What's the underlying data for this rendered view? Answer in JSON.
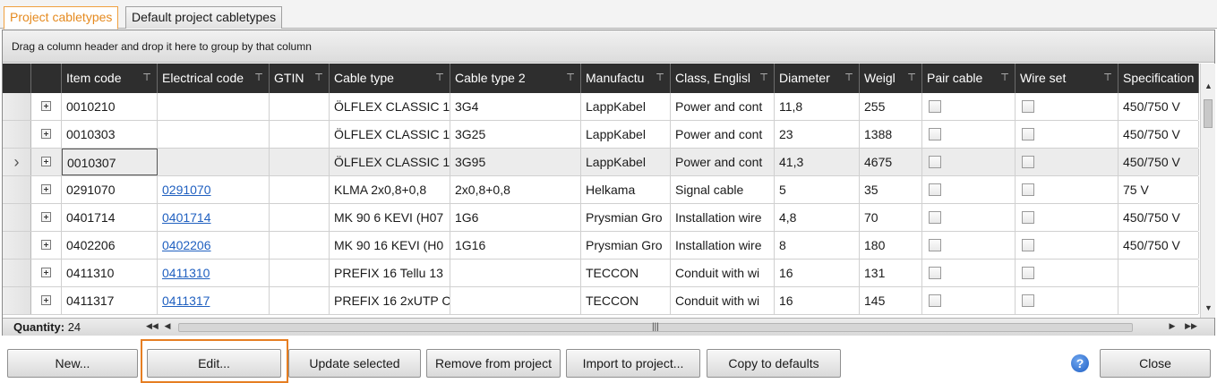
{
  "tabs": [
    {
      "label": "Project cabletypes",
      "active": true
    },
    {
      "label": "Default project cabletypes",
      "active": false
    }
  ],
  "group_panel_text": "Drag a column header and drop it here to group by that column",
  "columns": [
    "Item code",
    "Electrical code",
    "GTIN",
    "Cable type",
    "Cable type 2",
    "Manufactu",
    "Class, Englisl",
    "Diameter",
    "Weigl",
    "Pair cable",
    "Wire set",
    "Specification"
  ],
  "rows": [
    {
      "item_code": "0010210",
      "electrical_code": "",
      "gtin": "",
      "cable_type": "ÖLFLEX CLASSIC 1(",
      "cable_type2": "3G4",
      "manufacturer": "LappKabel",
      "class": "Power and cont",
      "diameter": "11,8",
      "weight": "255",
      "specification": "450/750 V",
      "selected": false
    },
    {
      "item_code": "0010303",
      "electrical_code": "",
      "gtin": "",
      "cable_type": "ÖLFLEX CLASSIC 1(",
      "cable_type2": "3G25",
      "manufacturer": "LappKabel",
      "class": "Power and cont",
      "diameter": "23",
      "weight": "1388",
      "specification": "450/750 V",
      "selected": false
    },
    {
      "item_code": "0010307",
      "electrical_code": "",
      "gtin": "",
      "cable_type": "ÖLFLEX CLASSIC 1(",
      "cable_type2": "3G95",
      "manufacturer": "LappKabel",
      "class": "Power and cont",
      "diameter": "41,3",
      "weight": "4675",
      "specification": "450/750 V",
      "selected": true
    },
    {
      "item_code": "0291070",
      "electrical_code": "0291070",
      "gtin": "",
      "cable_type": "KLMA 2x0,8+0,8",
      "cable_type2": "2x0,8+0,8",
      "manufacturer": "Helkama",
      "class": "Signal cable",
      "diameter": "5",
      "weight": "35",
      "specification": "75 V",
      "selected": false
    },
    {
      "item_code": "0401714",
      "electrical_code": "0401714",
      "gtin": "",
      "cable_type": "MK 90 6 KEVI (H07",
      "cable_type2": "1G6",
      "manufacturer": "Prysmian Gro",
      "class": "Installation wire",
      "diameter": "4,8",
      "weight": "70",
      "specification": "450/750 V",
      "selected": false
    },
    {
      "item_code": "0402206",
      "electrical_code": "0402206",
      "gtin": "",
      "cable_type": "MK 90 16 KEVI (H0",
      "cable_type2": "1G16",
      "manufacturer": "Prysmian Gro",
      "class": "Installation wire",
      "diameter": "8",
      "weight": "180",
      "specification": "450/750 V",
      "selected": false
    },
    {
      "item_code": "0411310",
      "electrical_code": "0411310",
      "gtin": "",
      "cable_type": "PREFIX 16 Tellu 13",
      "cable_type2": "",
      "manufacturer": "TECCON",
      "class": "Conduit with wi",
      "diameter": "16",
      "weight": "131",
      "specification": "",
      "selected": false
    },
    {
      "item_code": "0411317",
      "electrical_code": "0411317",
      "gtin": "",
      "cable_type": "PREFIX 16 2xUTP C",
      "cable_type2": "",
      "manufacturer": "TECCON",
      "class": "Conduit with wi",
      "diameter": "16",
      "weight": "145",
      "specification": "",
      "selected": false
    }
  ],
  "footer": {
    "quantity_label": "Quantity:",
    "quantity_value": "24"
  },
  "buttons": {
    "new": "New...",
    "edit": "Edit...",
    "update": "Update selected",
    "remove": "Remove from project",
    "import": "Import to project...",
    "copy": "Copy to defaults",
    "close": "Close",
    "help": "?"
  },
  "colors": {
    "accent": "#e67e22",
    "header_bg": "#2e2e2e",
    "link": "#2060c0"
  }
}
